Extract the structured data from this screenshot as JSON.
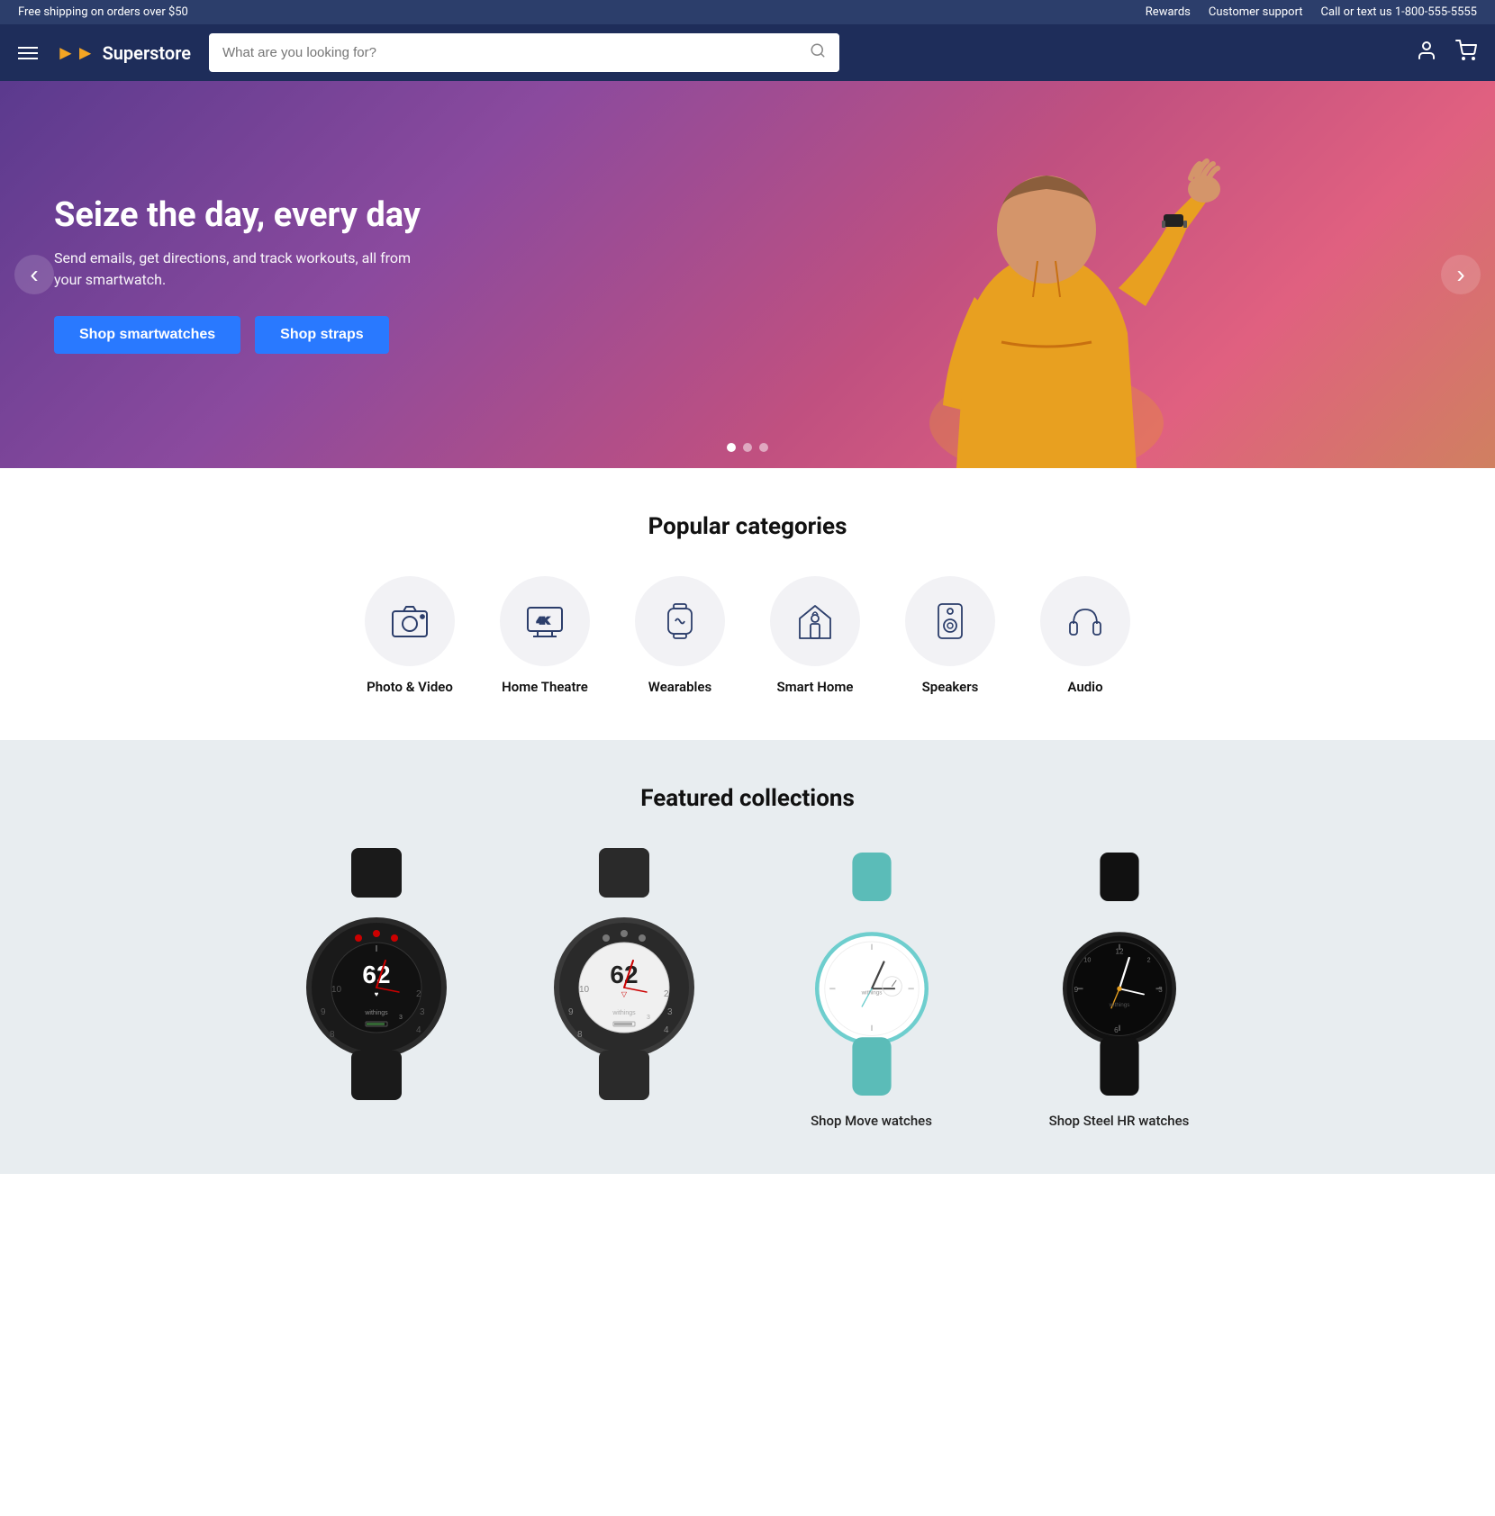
{
  "topbar": {
    "shipping": "Free shipping on orders over $50",
    "rewards": "Rewards",
    "support": "Customer support",
    "phone": "Call or text us 1-800-555-5555"
  },
  "header": {
    "logo_text": "Superstore",
    "search_placeholder": "What are you looking for?"
  },
  "hero": {
    "title": "Seize the day, every day",
    "subtitle": "Send emails, get directions, and track workouts, all from your smartwatch.",
    "btn1": "Shop smartwatches",
    "btn2": "Shop straps",
    "dots": [
      true,
      false,
      false
    ]
  },
  "categories": {
    "title": "Popular categories",
    "items": [
      {
        "label": "Photo & Video",
        "icon": "camera"
      },
      {
        "label": "Home Theatre",
        "icon": "tv4k"
      },
      {
        "label": "Wearables",
        "icon": "watch"
      },
      {
        "label": "Smart Home",
        "icon": "smarthome"
      },
      {
        "label": "Speakers",
        "icon": "speaker"
      },
      {
        "label": "Audio",
        "icon": "headphones"
      }
    ]
  },
  "featured": {
    "title": "Featured collections",
    "items": [
      {
        "label": "",
        "type": "dark-watches"
      },
      {
        "label": "",
        "type": "dark-watches-2"
      },
      {
        "label": "Shop Move watches",
        "type": "teal-watch"
      },
      {
        "label": "Shop Steel HR watches",
        "type": "black-watch"
      }
    ]
  }
}
